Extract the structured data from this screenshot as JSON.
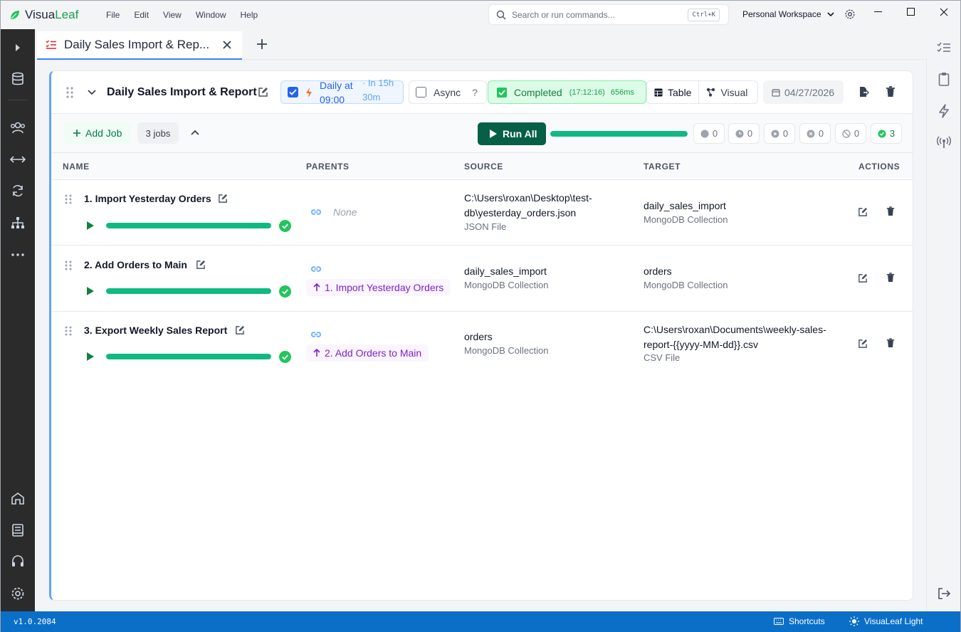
{
  "app": {
    "name_prefix": "Visua",
    "name_suffix": "Leaf",
    "menu": [
      "File",
      "Edit",
      "View",
      "Window",
      "Help"
    ],
    "search_placeholder": "Search or run commands...",
    "search_shortcut": "Ctrl+K",
    "workspace": "Personal Workspace"
  },
  "tabs": [
    {
      "title": "Daily Sales Import & Rep..."
    }
  ],
  "pipeline": {
    "title": "Daily Sales Import & Report",
    "schedule_label": "Daily at 09:00",
    "schedule_eta": "· In 15h 30m",
    "async_label": "Async",
    "async_help": "?",
    "status_label": "Completed",
    "status_time": "(17:12:16)",
    "status_duration": "656ms",
    "view_table": "Table",
    "view_visual": "Visual",
    "date": "04/27/2026",
    "add_job_label": "Add Job",
    "jobs_count": "3 jobs",
    "run_all_label": "Run All",
    "overall_progress": 1.0,
    "stats": {
      "pending": "0",
      "scheduled": "0",
      "running": "0",
      "failed": "0",
      "skipped": "0",
      "success": "3"
    }
  },
  "table": {
    "headers": {
      "name": "NAME",
      "parents": "PARENTS",
      "source": "SOURCE",
      "target": "TARGET",
      "actions": "ACTIONS"
    },
    "rows": [
      {
        "name": "1. Import Yesterday Orders",
        "progress": 1.0,
        "parent": "None",
        "source_main_1": "C:\\Users\\roxan\\Desktop\\test-",
        "source_main_2": "db\\yesterday_orders.json",
        "source_type": "JSON File",
        "target_main_1": "daily_sales_import",
        "target_main_2": "",
        "target_type": "MongoDB Collection"
      },
      {
        "name": "2. Add Orders to Main",
        "progress": 1.0,
        "parent": "1. Import Yesterday Orders",
        "source_main_1": "daily_sales_import",
        "source_main_2": "",
        "source_type": "MongoDB Collection",
        "target_main_1": "orders",
        "target_main_2": "",
        "target_type": "MongoDB Collection"
      },
      {
        "name": "3. Export Weekly Sales Report",
        "progress": 1.0,
        "parent": "2. Add Orders to Main",
        "source_main_1": "orders",
        "source_main_2": "",
        "source_type": "MongoDB Collection",
        "target_main_1": "C:\\Users\\roxan\\Documents\\weekly-sales-",
        "target_main_2": "report-{{yyyy-MM-dd}}.csv",
        "target_type": "CSV File"
      }
    ]
  },
  "statusbar": {
    "version": "v1.0.2084",
    "shortcuts": "Shortcuts",
    "theme": "VisuaLeaf Light"
  },
  "colors": {
    "brand_green": "#16a34a",
    "accent_blue": "#3b82f6",
    "run_button": "#065f46",
    "progress": "#10b981",
    "statusbar": "#0b6fc7",
    "parent_purple": "#7e22ce"
  }
}
